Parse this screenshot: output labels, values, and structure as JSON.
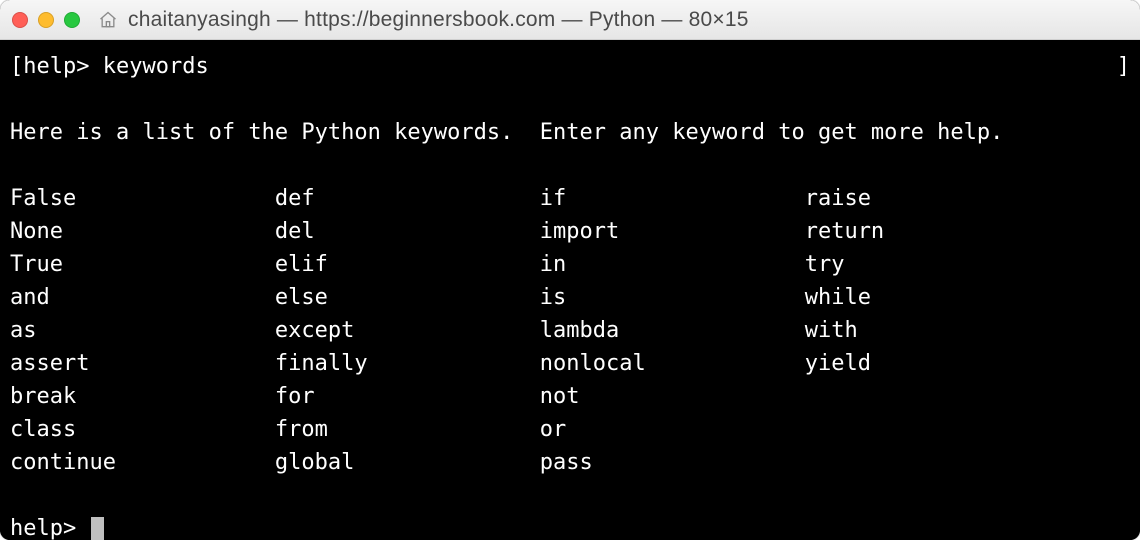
{
  "titlebar": {
    "home_icon_name": "home-icon",
    "title": "chaitanyasingh — https://beginnersbook.com — Python — 80×15"
  },
  "terminal": {
    "prompt_bracket_open": "[",
    "prompt_label": "help> ",
    "prompt_bracket_close": "]",
    "input_command": "keywords",
    "intro": "Here is a list of the Python keywords.  Enter any keyword to get more help.",
    "columns": [
      [
        "False",
        "None",
        "True",
        "and",
        "as",
        "assert",
        "break",
        "class",
        "continue"
      ],
      [
        "def",
        "del",
        "elif",
        "else",
        "except",
        "finally",
        "for",
        "from",
        "global"
      ],
      [
        "if",
        "import",
        "in",
        "is",
        "lambda",
        "nonlocal",
        "not",
        "or",
        "pass"
      ],
      [
        "raise",
        "return",
        "try",
        "while",
        "with",
        "yield"
      ]
    ],
    "second_prompt_label": "help> "
  },
  "layout": {
    "col_width_chars": 20,
    "rows": 9
  }
}
